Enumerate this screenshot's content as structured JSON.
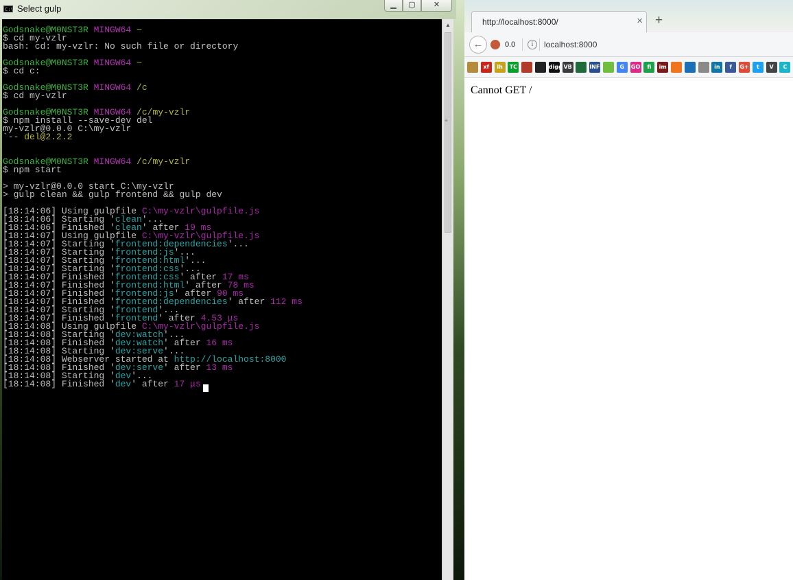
{
  "terminal": {
    "title": "Select gulp",
    "icon": "cmd-icon",
    "lines": [
      [
        {
          "t": "Godsnake@M0NST3R ",
          "c": "u"
        },
        {
          "t": "MINGW64 ",
          "c": "h"
        },
        {
          "t": "~",
          "c": "p"
        }
      ],
      [
        {
          "t": "$ cd my-vzlr"
        }
      ],
      [
        {
          "t": "bash: cd: my-vzlr: No such file or directory"
        }
      ],
      [],
      [
        {
          "t": "Godsnake@M0NST3R ",
          "c": "u"
        },
        {
          "t": "MINGW64 ",
          "c": "h"
        },
        {
          "t": "~",
          "c": "p"
        }
      ],
      [
        {
          "t": "$ cd c:"
        }
      ],
      [],
      [
        {
          "t": "Godsnake@M0NST3R ",
          "c": "u"
        },
        {
          "t": "MINGW64 ",
          "c": "h"
        },
        {
          "t": "/c",
          "c": "p"
        }
      ],
      [
        {
          "t": "$ cd my-vzlr"
        }
      ],
      [],
      [
        {
          "t": "Godsnake@M0NST3R ",
          "c": "u"
        },
        {
          "t": "MINGW64 ",
          "c": "h"
        },
        {
          "t": "/c/my-vzlr",
          "c": "p"
        }
      ],
      [
        {
          "t": "$ npm install --save-dev del"
        }
      ],
      [
        {
          "t": "my-vzlr@0.0.0 C:\\my-vzlr"
        }
      ],
      [
        {
          "t": "`-- "
        },
        {
          "t": "del@2.2.2",
          "c": "p"
        }
      ],
      [],
      [],
      [
        {
          "t": "Godsnake@M0NST3R ",
          "c": "u"
        },
        {
          "t": "MINGW64 ",
          "c": "h"
        },
        {
          "t": "/c/my-vzlr",
          "c": "p"
        }
      ],
      [
        {
          "t": "$ npm start"
        }
      ],
      [],
      [
        {
          "t": "> my-vzlr@0.0.0 start C:\\my-vzlr"
        }
      ],
      [
        {
          "t": "> gulp clean && gulp frontend && gulp dev"
        }
      ],
      [],
      [
        {
          "t": "[18:14:06] Using gulpfile "
        },
        {
          "t": "C:\\my-vzlr\\gulpfile.js",
          "c": "m"
        }
      ],
      [
        {
          "t": "[18:14:06] Starting '"
        },
        {
          "t": "clean",
          "c": "c"
        },
        {
          "t": "'..."
        }
      ],
      [
        {
          "t": "[18:14:06] Finished '"
        },
        {
          "t": "clean",
          "c": "c"
        },
        {
          "t": "' after "
        },
        {
          "t": "19 ms",
          "c": "m"
        }
      ],
      [
        {
          "t": "[18:14:07] Using gulpfile "
        },
        {
          "t": "C:\\my-vzlr\\gulpfile.js",
          "c": "m"
        }
      ],
      [
        {
          "t": "[18:14:07] Starting '"
        },
        {
          "t": "frontend:dependencies",
          "c": "c"
        },
        {
          "t": "'..."
        }
      ],
      [
        {
          "t": "[18:14:07] Starting '"
        },
        {
          "t": "frontend:js",
          "c": "c"
        },
        {
          "t": "'..."
        }
      ],
      [
        {
          "t": "[18:14:07] Starting '"
        },
        {
          "t": "frontend:html",
          "c": "c"
        },
        {
          "t": "'..."
        }
      ],
      [
        {
          "t": "[18:14:07] Starting '"
        },
        {
          "t": "frontend:css",
          "c": "c"
        },
        {
          "t": "'..."
        }
      ],
      [
        {
          "t": "[18:14:07] Finished '"
        },
        {
          "t": "frontend:css",
          "c": "c"
        },
        {
          "t": "' after "
        },
        {
          "t": "17 ms",
          "c": "m"
        }
      ],
      [
        {
          "t": "[18:14:07] Finished '"
        },
        {
          "t": "frontend:html",
          "c": "c"
        },
        {
          "t": "' after "
        },
        {
          "t": "78 ms",
          "c": "m"
        }
      ],
      [
        {
          "t": "[18:14:07] Finished '"
        },
        {
          "t": "frontend:js",
          "c": "c"
        },
        {
          "t": "' after "
        },
        {
          "t": "90 ms",
          "c": "m"
        }
      ],
      [
        {
          "t": "[18:14:07] Finished '"
        },
        {
          "t": "frontend:dependencies",
          "c": "c"
        },
        {
          "t": "' after "
        },
        {
          "t": "112 ms",
          "c": "m"
        }
      ],
      [
        {
          "t": "[18:14:07] Starting '"
        },
        {
          "t": "frontend",
          "c": "c"
        },
        {
          "t": "'..."
        }
      ],
      [
        {
          "t": "[18:14:07] Finished '"
        },
        {
          "t": "frontend",
          "c": "c"
        },
        {
          "t": "' after "
        },
        {
          "t": "4.53 μs",
          "c": "m"
        }
      ],
      [
        {
          "t": "[18:14:08] Using gulpfile "
        },
        {
          "t": "C:\\my-vzlr\\gulpfile.js",
          "c": "m"
        }
      ],
      [
        {
          "t": "[18:14:08] Starting '"
        },
        {
          "t": "dev:watch",
          "c": "c"
        },
        {
          "t": "'..."
        }
      ],
      [
        {
          "t": "[18:14:08] Finished '"
        },
        {
          "t": "dev:watch",
          "c": "c"
        },
        {
          "t": "' after "
        },
        {
          "t": "16 ms",
          "c": "m"
        }
      ],
      [
        {
          "t": "[18:14:08] Starting '"
        },
        {
          "t": "dev:serve",
          "c": "c"
        },
        {
          "t": "'..."
        }
      ],
      [
        {
          "t": "[18:14:08] Webserver started at "
        },
        {
          "t": "http://localhost:8000",
          "c": "c"
        }
      ],
      [
        {
          "t": "[18:14:08] Finished '"
        },
        {
          "t": "dev:serve",
          "c": "c"
        },
        {
          "t": "' after "
        },
        {
          "t": "13 ms",
          "c": "m"
        }
      ],
      [
        {
          "t": "[18:14:08] Starting '"
        },
        {
          "t": "dev",
          "c": "c"
        },
        {
          "t": "'..."
        }
      ],
      [
        {
          "t": "[18:14:08] Finished '"
        },
        {
          "t": "dev",
          "c": "c"
        },
        {
          "t": "' after "
        },
        {
          "t": "17 μs",
          "c": "m"
        }
      ]
    ]
  },
  "browser": {
    "tab_title": "http://localhost:8000/",
    "addon_value": "0.0",
    "url": "localhost:8000",
    "bookmarks": [
      {
        "name": "bookmark-1-icon",
        "label": "",
        "color": "#b58a3c"
      },
      {
        "name": "bookmark-xf-icon",
        "label": "xf",
        "color": "#c8261b"
      },
      {
        "name": "bookmark-lh-icon",
        "label": "lh",
        "color": "#c8a21b"
      },
      {
        "name": "bookmark-tc-icon",
        "label": "TC",
        "color": "#0a9e2b"
      },
      {
        "name": "bookmark-5-icon",
        "label": "",
        "color": "#b33b2a"
      },
      {
        "name": "bookmark-6-icon",
        "label": "",
        "color": "#222222"
      },
      {
        "name": "bookmark-digg-icon",
        "label": "digg",
        "color": "#111111"
      },
      {
        "name": "bookmark-vb-icon",
        "label": "VB",
        "color": "#3a3a3a"
      },
      {
        "name": "bookmark-9-icon",
        "label": "",
        "color": "#1f6b3a"
      },
      {
        "name": "bookmark-infowars-icon",
        "label": "INFO",
        "color": "#2a4f8f"
      },
      {
        "name": "bookmark-leaf-icon",
        "label": "",
        "color": "#6fbf3c"
      },
      {
        "name": "bookmark-google-icon",
        "label": "G",
        "color": "#4285f4"
      },
      {
        "name": "bookmark-go-icon",
        "label": "GO",
        "color": "#e02a8a"
      },
      {
        "name": "bookmark-fi-icon",
        "label": "fi",
        "color": "#1ea04a"
      },
      {
        "name": "bookmark-imdb-icon",
        "label": "im",
        "color": "#7a1a1a"
      },
      {
        "name": "bookmark-16-icon",
        "label": "",
        "color": "#f0761e"
      },
      {
        "name": "bookmark-17-icon",
        "label": "",
        "color": "#1b6fb5"
      },
      {
        "name": "bookmark-18-icon",
        "label": "",
        "color": "#8a8a8a"
      },
      {
        "name": "bookmark-linkedin-icon",
        "label": "in",
        "color": "#0e76a8"
      },
      {
        "name": "bookmark-facebook-icon",
        "label": "f",
        "color": "#3b5998"
      },
      {
        "name": "bookmark-gplus-icon",
        "label": "G+",
        "color": "#dd4b39"
      },
      {
        "name": "bookmark-twitter-icon",
        "label": "t",
        "color": "#1da1f2"
      },
      {
        "name": "bookmark-vimeo-icon",
        "label": "V",
        "color": "#444444"
      },
      {
        "name": "bookmark-c-icon",
        "label": "C",
        "color": "#1bb5c8"
      }
    ],
    "page_message": "Cannot GET /"
  }
}
